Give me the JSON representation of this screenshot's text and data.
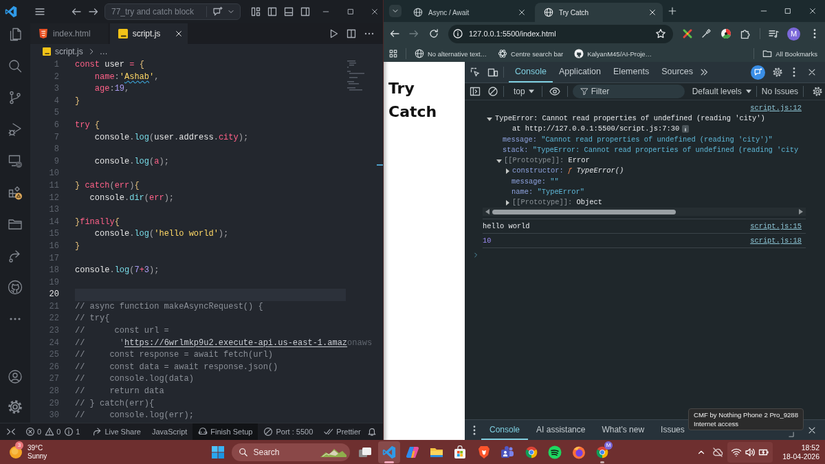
{
  "vscode": {
    "command_center": "77_try and catch block",
    "tabs": [
      {
        "label": "index.html",
        "kind": "html",
        "selected": false
      },
      {
        "label": "script.js",
        "kind": "js",
        "selected": true
      }
    ],
    "breadcrumb": {
      "file": "script.js",
      "symbol": "…"
    },
    "editor": {
      "lines": [
        {
          "number": "1",
          "current": false,
          "tokens": [
            {
              "kind": "keyword",
              "text": "const"
            },
            {
              "kind": "plain",
              "text": " user "
            },
            {
              "kind": "operator",
              "text": "="
            },
            {
              "kind": "brace",
              "text": " {"
            }
          ]
        },
        {
          "number": "2",
          "current": false,
          "tokens": [
            {
              "kind": "property",
              "text": "    name"
            },
            {
              "kind": "punct",
              "text": ":"
            },
            {
              "kind": "string",
              "text": "'"
            },
            {
              "kind": "string",
              "text": "Ashab",
              "squiggle": true
            },
            {
              "kind": "string",
              "text": "'"
            },
            {
              "kind": "punct",
              "text": ","
            }
          ]
        },
        {
          "number": "3",
          "current": false,
          "tokens": [
            {
              "kind": "property",
              "text": "    age"
            },
            {
              "kind": "punct",
              "text": ":"
            },
            {
              "kind": "number",
              "text": "19"
            },
            {
              "kind": "punct",
              "text": ","
            }
          ]
        },
        {
          "number": "4",
          "current": false,
          "tokens": [
            {
              "kind": "brace",
              "text": "}"
            }
          ]
        },
        {
          "number": "5",
          "current": false
        },
        {
          "number": "6",
          "current": false,
          "tokens": [
            {
              "kind": "keyword",
              "text": "try"
            },
            {
              "kind": "brace",
              "text": " {"
            }
          ]
        },
        {
          "number": "7",
          "current": false,
          "tokens": [
            {
              "kind": "plain",
              "text": "    console"
            },
            {
              "kind": "punct",
              "text": "."
            },
            {
              "kind": "method",
              "text": "log"
            },
            {
              "kind": "punct",
              "text": "("
            },
            {
              "kind": "plain",
              "text": "user"
            },
            {
              "kind": "punct",
              "text": "."
            },
            {
              "kind": "plain",
              "text": "address"
            },
            {
              "kind": "punct",
              "text": "."
            },
            {
              "kind": "property",
              "text": "city"
            },
            {
              "kind": "punct",
              "text": ");"
            }
          ]
        },
        {
          "number": "8",
          "current": false
        },
        {
          "number": "9",
          "current": false,
          "tokens": [
            {
              "kind": "plain",
              "text": "    console"
            },
            {
              "kind": "punct",
              "text": "."
            },
            {
              "kind": "method",
              "text": "log"
            },
            {
              "kind": "punct",
              "text": "("
            },
            {
              "kind": "property",
              "text": "a"
            },
            {
              "kind": "punct",
              "text": ");"
            }
          ]
        },
        {
          "number": "10",
          "current": false
        },
        {
          "number": "11",
          "current": false,
          "tokens": [
            {
              "kind": "brace",
              "text": "} "
            },
            {
              "kind": "keyword",
              "text": "catch"
            },
            {
              "kind": "punct",
              "text": "("
            },
            {
              "kind": "property",
              "text": "err"
            },
            {
              "kind": "punct",
              "text": ")"
            },
            {
              "kind": "brace",
              "text": "{"
            }
          ]
        },
        {
          "number": "12",
          "current": false,
          "tokens": [
            {
              "kind": "plain",
              "text": "   console"
            },
            {
              "kind": "punct",
              "text": "."
            },
            {
              "kind": "method",
              "text": "dir"
            },
            {
              "kind": "punct",
              "text": "("
            },
            {
              "kind": "property",
              "text": "err"
            },
            {
              "kind": "punct",
              "text": ");"
            }
          ]
        },
        {
          "number": "13",
          "current": false
        },
        {
          "number": "14",
          "current": false,
          "tokens": [
            {
              "kind": "brace",
              "text": "}"
            },
            {
              "kind": "keyword",
              "text": "finally"
            },
            {
              "kind": "brace",
              "text": "{"
            }
          ]
        },
        {
          "number": "15",
          "current": false,
          "tokens": [
            {
              "kind": "plain",
              "text": "    console"
            },
            {
              "kind": "punct",
              "text": "."
            },
            {
              "kind": "method",
              "text": "log"
            },
            {
              "kind": "punct",
              "text": "("
            },
            {
              "kind": "string",
              "text": "'hello world'"
            },
            {
              "kind": "punct",
              "text": ");"
            }
          ]
        },
        {
          "number": "16",
          "current": false,
          "tokens": [
            {
              "kind": "brace",
              "text": "}"
            }
          ]
        },
        {
          "number": "17",
          "current": false
        },
        {
          "number": "18",
          "current": false,
          "tokens": [
            {
              "kind": "plain",
              "text": "console"
            },
            {
              "kind": "punct",
              "text": "."
            },
            {
              "kind": "method",
              "text": "log"
            },
            {
              "kind": "punct",
              "text": "("
            },
            {
              "kind": "number",
              "text": "7"
            },
            {
              "kind": "operator",
              "text": "+"
            },
            {
              "kind": "number",
              "text": "3"
            },
            {
              "kind": "punct",
              "text": ");"
            }
          ]
        },
        {
          "number": "19",
          "current": false
        },
        {
          "number": "20",
          "current": true
        },
        {
          "number": "21",
          "current": false,
          "tokens": [
            {
              "kind": "comment",
              "text": "// async function makeAsyncRequest() {"
            }
          ]
        },
        {
          "number": "22",
          "current": false,
          "tokens": [
            {
              "kind": "comment",
              "text": "// try{"
            }
          ]
        },
        {
          "number": "23",
          "current": false,
          "tokens": [
            {
              "kind": "comment",
              "text": "//      const url ="
            }
          ]
        },
        {
          "number": "24",
          "current": false,
          "tokens": [
            {
              "kind": "comment",
              "text": "//       '"
            },
            {
              "kind": "link",
              "text": "https://6wrlmkp9u2.execute-api.us-east-1.amaz",
              "underlined": true
            },
            {
              "kind": "faded",
              "text": "onaws"
            }
          ]
        },
        {
          "number": "25",
          "current": false,
          "tokens": [
            {
              "kind": "comment",
              "text": "//     const response = await fetch(url)"
            }
          ]
        },
        {
          "number": "26",
          "current": false,
          "tokens": [
            {
              "kind": "comment",
              "text": "//     const data = await response.json()"
            }
          ]
        },
        {
          "number": "27",
          "current": false,
          "tokens": [
            {
              "kind": "comment",
              "text": "//     console.log(data)"
            }
          ]
        },
        {
          "number": "28",
          "current": false,
          "tokens": [
            {
              "kind": "comment",
              "text": "//     return data"
            }
          ]
        },
        {
          "number": "29",
          "current": false,
          "tokens": [
            {
              "kind": "comment",
              "text": "// } catch(err){"
            }
          ]
        },
        {
          "number": "30",
          "current": false,
          "tokens": [
            {
              "kind": "comment",
              "text": "//     console.log(err);"
            }
          ]
        }
      ]
    },
    "status_bar": {
      "problems": [
        {
          "kind": "error",
          "count": "0"
        },
        {
          "kind": "warning",
          "count": "0"
        },
        {
          "kind": "info",
          "count": "1"
        }
      ],
      "items": [
        {
          "kind": "live-share",
          "label": "Live Share",
          "highlighted": false
        },
        {
          "kind": "language",
          "label": "JavaScript",
          "highlighted": false
        },
        {
          "kind": "setup",
          "label": "Finish Setup",
          "highlighted": true
        },
        {
          "kind": "port",
          "label": "Port : 5500",
          "highlighted": false
        },
        {
          "kind": "formatter",
          "label": "Prettier",
          "highlighted": false
        }
      ]
    }
  },
  "browser": {
    "tabs": [
      {
        "title": "Async / Await",
        "selected": false
      },
      {
        "title": "Try Catch",
        "selected": true
      }
    ],
    "address": "127.0.0.1:5500/index.html",
    "profile": "M",
    "bookmarks": [
      {
        "kind": "globe",
        "label": "No alternative text…"
      },
      {
        "kind": "rosette",
        "label": "Centre search bar"
      },
      {
        "kind": "github",
        "label": "KalyanM45/AI-Proje…"
      }
    ],
    "all_bookmarks": "All Bookmarks",
    "page": {
      "heading": "Try Catch"
    }
  },
  "devtools": {
    "tabs": [
      {
        "label": "Console",
        "selected": true
      },
      {
        "label": "Application",
        "selected": false
      },
      {
        "label": "Elements",
        "selected": false
      },
      {
        "label": "Sources",
        "selected": false
      }
    ],
    "context": "top",
    "filter": {
      "placeholder": "Filter"
    },
    "levels": "Default levels",
    "issues": "No Issues",
    "messages": [
      {
        "kind": "object",
        "source": "script.js:12",
        "expanded": true,
        "summary": "TypeError: Cannot read properties of undefined (reading 'city')",
        "stack_line": "at http://127.0.0.1:5500/script.js:7:30",
        "properties": [
          {
            "key": "message:",
            "value": "\"Cannot read properties of undefined (reading 'city')\"",
            "kind": "string",
            "dimmed": false
          },
          {
            "key": "stack:",
            "value": "\"TypeError: Cannot read properties of undefined (reading 'city",
            "kind": "string",
            "dimmed": false
          },
          {
            "key": "[[Prototype]]:",
            "value": "Error",
            "kind": "object",
            "dimmed": true,
            "expanded": true,
            "children": [
              {
                "key": "constructor:",
                "prefix": "ƒ",
                "value": "TypeError()",
                "kind": "function",
                "dimmed": false,
                "expanded": false
              },
              {
                "key": "message:",
                "value": "\"\"",
                "kind": "string",
                "dimmed": false
              },
              {
                "key": "name:",
                "value": "\"TypeError\"",
                "kind": "string",
                "dimmed": false
              },
              {
                "key": "[[Prototype]]:",
                "value": "Object",
                "kind": "object",
                "dimmed": true,
                "expanded": false
              }
            ]
          }
        ]
      },
      {
        "kind": "text",
        "source": "script.js:15",
        "text": "hello world"
      },
      {
        "kind": "number",
        "source": "script.js:18",
        "text": "10"
      }
    ],
    "drawer_tabs": [
      {
        "label": "Console",
        "selected": true
      },
      {
        "label": "AI assistance",
        "selected": false
      },
      {
        "label": "What's new",
        "selected": false
      },
      {
        "label": "Issues",
        "selected": false
      }
    ]
  },
  "taskbar": {
    "weather": {
      "badge": "3",
      "temperature": "39°C",
      "condition": "Sunny"
    },
    "search": {
      "label": "Search"
    },
    "apps": [
      {
        "kind": "task-view",
        "active": false,
        "open": false
      },
      {
        "kind": "vscode",
        "active": true,
        "open": true
      },
      {
        "kind": "copilot",
        "active": false,
        "open": false
      },
      {
        "kind": "file-explorer",
        "active": false,
        "open": false
      },
      {
        "kind": "store",
        "active": false,
        "open": false
      },
      {
        "kind": "brave",
        "active": false,
        "open": false
      },
      {
        "kind": "teams",
        "active": false,
        "open": false
      },
      {
        "kind": "chrome",
        "active": false,
        "open": false
      },
      {
        "kind": "spotify",
        "active": false,
        "open": false
      },
      {
        "kind": "firefox",
        "active": false,
        "open": false
      },
      {
        "kind": "chrome-profile",
        "badge": "M",
        "active": false,
        "open": true
      }
    ],
    "clock": {
      "time": "18:52",
      "date": "18-04-2026"
    },
    "tooltip": {
      "network": "CMF by Nothing Phone 2 Pro_9288",
      "status": "Internet access"
    }
  }
}
